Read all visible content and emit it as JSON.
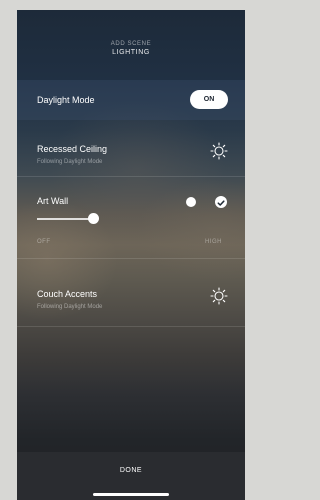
{
  "header": {
    "subtitle": "ADD SCENE",
    "title": "LIGHTING"
  },
  "daylight_mode": {
    "label": "Daylight Mode",
    "toggle_label": "ON"
  },
  "lights": [
    {
      "name": "Recessed Ceiling",
      "status": "Following Daylight Mode",
      "icon": "sun-icon"
    },
    {
      "name": "Art Wall",
      "status": "",
      "icon": "check-toggle"
    },
    {
      "name": "Couch Accents",
      "status": "Following Daylight Mode",
      "icon": "sun-icon"
    }
  ],
  "slider": {
    "min_label": "OFF",
    "max_label": "HIGH",
    "level": 0.3
  },
  "footer": {
    "done_label": "DONE"
  }
}
